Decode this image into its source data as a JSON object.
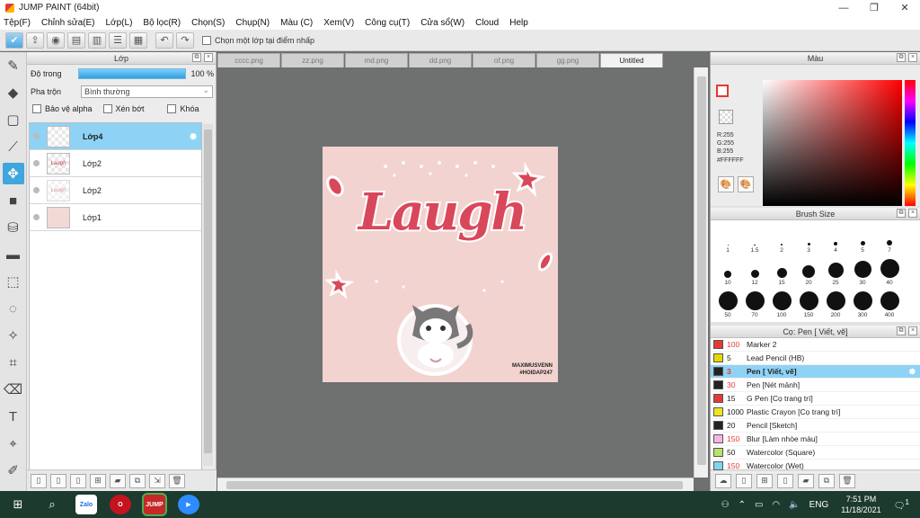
{
  "window": {
    "title": "JUMP PAINT (64bit)",
    "minimize": "—",
    "maximize": "❐",
    "close": "✕"
  },
  "menu": [
    "Tệp(F)",
    "Chỉnh sửa(E)",
    "Lớp(L)",
    "Bộ lọc(R)",
    "Chọn(S)",
    "Chụp(N)",
    "Màu (C)",
    "Xem(V)",
    "Công cụ(T)",
    "Cửa sổ(W)",
    "Cloud",
    "Help"
  ],
  "toolbar": {
    "checkbox_label": "Chọn một lớp tại điểm nhấp"
  },
  "layer_panel": {
    "title": "Lớp",
    "opacity_label": "Độ trong",
    "opacity_value": "100 %",
    "blend_label": "Pha trộn",
    "blend_value": "Bình thường",
    "locks": [
      "Bảo vệ alpha",
      "Xén bớt",
      "Khóa"
    ],
    "layers": [
      {
        "name": "Lớp4",
        "selected": true
      },
      {
        "name": "Lớp2",
        "selected": false,
        "thumb_text": "Laugh"
      },
      {
        "name": "Lớp2",
        "selected": false,
        "thumb_text": "Laugh"
      },
      {
        "name": "Lớp1",
        "selected": false
      }
    ]
  },
  "tabs": [
    {
      "label": "cccc.png",
      "active": false
    },
    {
      "label": "zz.png",
      "active": false
    },
    {
      "label": "md.png",
      "active": false
    },
    {
      "label": "dd.png",
      "active": false
    },
    {
      "label": "of.png",
      "active": false
    },
    {
      "label": "gg.png",
      "active": false
    },
    {
      "label": "Untitled",
      "active": true
    }
  ],
  "artwork": {
    "word": "Laugh",
    "credit_line1": "MAXIMUSVENN",
    "credit_line2": "#HOIDAP247",
    "background": "#f2d3cf",
    "accent": "#d9475b"
  },
  "color_panel": {
    "title": "Màu",
    "r": "R:255",
    "g": "G:255",
    "b": "B:255",
    "hex": "#FFFFFF",
    "foreground": "#e53935",
    "background": "#FFFFFF"
  },
  "brush_panel": {
    "title": "Brush Size",
    "sizes": [
      "1",
      "1.5",
      "2",
      "3",
      "4",
      "5",
      "7",
      "10",
      "12",
      "15",
      "20",
      "25",
      "30",
      "40",
      "50",
      "70",
      "100",
      "150",
      "200",
      "300",
      "400"
    ]
  },
  "tool_panel": {
    "title": "Cọ: Pen [ Viết, vẽ]",
    "tools": [
      {
        "size": "100",
        "name": "Marker 2",
        "color": "#e53935",
        "size_red": true
      },
      {
        "size": "5",
        "name": "Lead Pencil (HB)",
        "color": "#e8d600",
        "size_red": false
      },
      {
        "size": "3",
        "name": "Pen [ Viết, vẽ]",
        "color": "#222222",
        "size_red": true,
        "selected": true
      },
      {
        "size": "30",
        "name": "Pen [Nét mảnh]",
        "color": "#222222",
        "size_red": true
      },
      {
        "size": "15",
        "name": "G Pen [Cọ trang trí]",
        "color": "#e53935",
        "size_red": false
      },
      {
        "size": "1000",
        "name": "Plastic Crayon [Cọ trang trí]",
        "color": "#f2e31f",
        "size_red": false
      },
      {
        "size": "20",
        "name": "Pencil [Sketch]",
        "color": "#222222",
        "size_red": false
      },
      {
        "size": "150",
        "name": "Blur [Làm nhòe màu]",
        "color": "#f7b3e8",
        "size_red": true
      },
      {
        "size": "50",
        "name": "Watercolor (Square)",
        "color": "#b7e36a",
        "size_red": false
      },
      {
        "size": "150",
        "name": "Watercolor (Wet)",
        "color": "#7fd3f0",
        "size_red": true
      }
    ]
  },
  "taskbar": {
    "apps": [
      {
        "label": "Zalo",
        "color": "#ffffff",
        "text_color": "#1c6fd6"
      },
      {
        "label": "O",
        "color": "#c4141f",
        "text_color": "#ffffff"
      },
      {
        "label": "JUMP",
        "color": "#c62828",
        "text_color": "#ffffff"
      },
      {
        "label": "▶",
        "color": "#2d8cff",
        "text_color": "#ffffff"
      }
    ],
    "lang": "ENG",
    "time": "7:51 PM",
    "date": "11/18/2021",
    "notifications": "1"
  }
}
